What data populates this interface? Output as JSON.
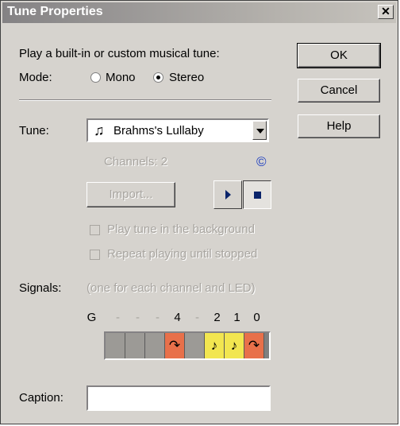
{
  "window": {
    "title": "Tune Properties",
    "close_glyph": "✕"
  },
  "description": "Play a built-in or custom musical tune:",
  "mode": {
    "label": "Mode:",
    "options": [
      {
        "label": "Mono",
        "selected": false
      },
      {
        "label": "Stereo",
        "selected": true
      }
    ]
  },
  "buttons": {
    "ok": "OK",
    "cancel": "Cancel",
    "help": "Help"
  },
  "tune": {
    "label": "Tune:",
    "selected": "Brahms's Lullaby",
    "icon": "music-note-icon",
    "note_glyph": "♫"
  },
  "channels": {
    "text": "Channels: 2",
    "copyright_glyph": "©"
  },
  "import_label": "Import...",
  "checkboxes": [
    {
      "label": "Play tune in the background",
      "checked": false
    },
    {
      "label": "Repeat playing until stopped",
      "checked": false
    }
  ],
  "signals": {
    "label": "Signals:",
    "hint": "(one for each channel and LED)",
    "headers": [
      "G",
      "-",
      "-",
      "-",
      "4",
      "-",
      "2",
      "1",
      "0"
    ],
    "cells": [
      {
        "color": "gray",
        "glyph": ""
      },
      {
        "color": "gray",
        "glyph": ""
      },
      {
        "color": "gray",
        "glyph": ""
      },
      {
        "color": "orange",
        "glyph": "↷"
      },
      {
        "color": "gray",
        "glyph": ""
      },
      {
        "color": "yellow",
        "glyph": "♪"
      },
      {
        "color": "yellow",
        "glyph": "♪"
      },
      {
        "color": "orange",
        "glyph": "↷"
      }
    ]
  },
  "caption": {
    "label": "Caption:",
    "value": ""
  }
}
